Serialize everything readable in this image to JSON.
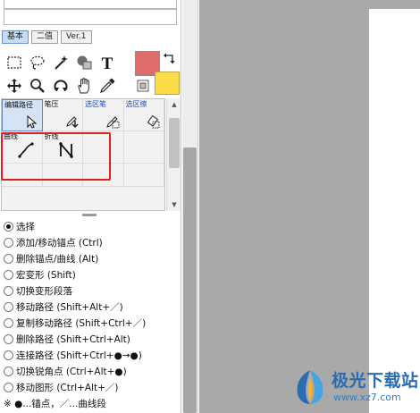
{
  "tabs": [
    {
      "label": "基本",
      "active": true
    },
    {
      "label": "二值",
      "active": false
    },
    {
      "label": "Ver.1",
      "active": false
    }
  ],
  "tools": [
    {
      "name": "rect-select-icon"
    },
    {
      "name": "lasso-icon"
    },
    {
      "name": "magic-wand-icon"
    },
    {
      "name": "shape-icon"
    },
    {
      "name": "text-tool-icon",
      "glyph": "T"
    },
    {
      "name": "move-icon"
    },
    {
      "name": "zoom-icon"
    },
    {
      "name": "rotate-icon"
    },
    {
      "name": "hand-icon"
    },
    {
      "name": "eyedropper-icon"
    }
  ],
  "colors": {
    "main": "#e06c6d",
    "sub": "#fddc4a",
    "accent": "#e02020"
  },
  "subtools_row1": [
    {
      "label": "编辑路径",
      "active": true,
      "blue": false,
      "icon": "cursor-icon"
    },
    {
      "label": "笔压",
      "active": false,
      "blue": false,
      "icon": "pen-pressure-icon"
    },
    {
      "label": "选区笔",
      "active": false,
      "blue": true,
      "icon": "selection-pen-icon"
    },
    {
      "label": "选区擦",
      "active": false,
      "blue": true,
      "icon": "selection-eraser-icon"
    }
  ],
  "subtools_row2": [
    {
      "label": "曲线",
      "icon": "curve-icon"
    },
    {
      "label": "折线",
      "icon": "polyline-icon"
    }
  ],
  "options": [
    {
      "label": "选择",
      "checked": true
    },
    {
      "label": "添加/移动锚点 (Ctrl)",
      "checked": false
    },
    {
      "label": "删除锚点/曲线 (Alt)",
      "checked": false
    },
    {
      "label": "宏变形 (Shift)",
      "checked": false
    },
    {
      "label": "切换变形段落",
      "checked": false
    },
    {
      "label": "移动路径 (Shift+Alt+／)",
      "checked": false
    },
    {
      "label": "复制移动路径 (Shift+Ctrl+／)",
      "checked": false
    },
    {
      "label": "删除路径 (Shift+Ctrl+Alt)",
      "checked": false
    },
    {
      "label": "连接路径 (Shift+Ctrl+●→●)",
      "checked": false
    },
    {
      "label": "切换锐角点 (Ctrl+Alt+●)",
      "checked": false
    },
    {
      "label": "移动图形 (Ctrl+Alt+／)",
      "checked": false
    }
  ],
  "legend": "※ ●...锚点，／...曲线段",
  "watermark": {
    "title": "极光下载站",
    "url": "www.xz7.com"
  }
}
